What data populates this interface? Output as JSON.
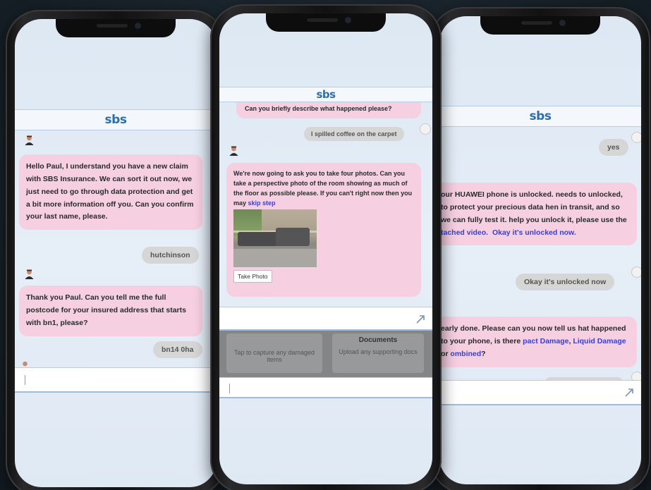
{
  "brand": {
    "logo": "sbs",
    "accent": "#2f6fa8",
    "bot_bubble": "#f6cfe0",
    "user_bubble": "#d6d6d6"
  },
  "phone1": {
    "messages": [
      {
        "from": "bot",
        "text": "Hello Paul, I understand you have a new claim with SBS Insurance. We can sort it out now, we just need to go through data protection and get a bit more information off you. Can you confirm your last name, please."
      },
      {
        "from": "user",
        "text": "hutchinson"
      },
      {
        "from": "bot",
        "text": "Thank you Paul. Can you tell me the full postcode for your insured address that starts with bn1, please?"
      },
      {
        "from": "user",
        "text": "bn14 0ha"
      }
    ]
  },
  "phone2": {
    "messages": [
      {
        "from": "bot",
        "text": "Can you briefly describe what happened please?"
      },
      {
        "from": "user",
        "text": "I spilled coffee on the carpet"
      },
      {
        "from": "bot",
        "text": "We're now going to ask you to take four photos. Can you take a perspective photo of the room showing as much of the floor as possible please. If you can't right now then you may ",
        "link": "skip step"
      }
    ],
    "take_photo_label": "Take Photo",
    "overlay_cards": [
      {
        "text": "Tap to capture any damaged items"
      },
      {
        "title": "Documents",
        "text": "Upload any supporting docs"
      }
    ]
  },
  "phone3": {
    "messages": [
      {
        "from": "user",
        "text": "yes"
      },
      {
        "from": "bot",
        "text_before": "our HUAWEI phone is unlocked. needs to unlocked, to protect your precious data hen in transit, and so we can fully test it. help you unlock it, please use the ",
        "link1": "tached video.",
        "link2": "Okay it's unlocked now."
      },
      {
        "from": "user",
        "text": "Okay it's unlocked now"
      },
      {
        "from": "bot",
        "text_before": "early done. Please can you now tell us hat happened to your phone, is there ",
        "link1": "pact Damage",
        "sep": ", ",
        "link2": "Liquid Damage",
        "mid": " or ",
        "link3": "ombined",
        "end": "?"
      }
    ]
  }
}
